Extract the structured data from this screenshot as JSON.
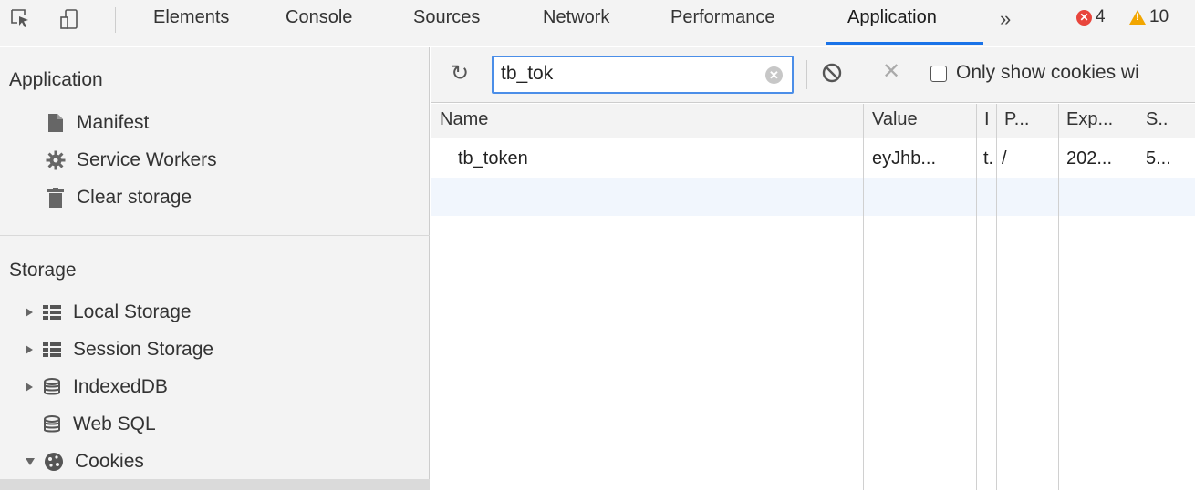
{
  "tabs": {
    "items": [
      "Elements",
      "Console",
      "Sources",
      "Network",
      "Performance",
      "Application"
    ],
    "more": "»",
    "errors": "4",
    "warnings": "10"
  },
  "sidebar": {
    "application_title": "Application",
    "application_items": [
      {
        "label": "Manifest",
        "icon": "document-icon"
      },
      {
        "label": "Service Workers",
        "icon": "gear-icon"
      },
      {
        "label": "Clear storage",
        "icon": "trash-icon"
      }
    ],
    "storage_title": "Storage",
    "storage_items": [
      {
        "label": "Local Storage",
        "icon": "grid-icon",
        "expander": "collapsed"
      },
      {
        "label": "Session Storage",
        "icon": "grid-icon",
        "expander": "collapsed"
      },
      {
        "label": "IndexedDB",
        "icon": "database-icon",
        "expander": "collapsed"
      },
      {
        "label": "Web SQL",
        "icon": "database-icon",
        "expander": "none"
      },
      {
        "label": "Cookies",
        "icon": "cookie-icon",
        "expander": "expanded"
      }
    ]
  },
  "toolbar": {
    "filter_value": "tb_tok",
    "only_show_label": "Only show cookies wi"
  },
  "table": {
    "columns": [
      "Name",
      "Value",
      "I",
      "P...",
      "Exp...",
      "S.."
    ],
    "rows": [
      {
        "name": "tb_token",
        "value": "eyJhb...",
        "domain": "t.",
        "path": "/",
        "expires": "202...",
        "size": "5..."
      }
    ]
  },
  "colors": {
    "accent": "#1a73e8",
    "error": "#e8453c",
    "warning": "#f2a600"
  }
}
